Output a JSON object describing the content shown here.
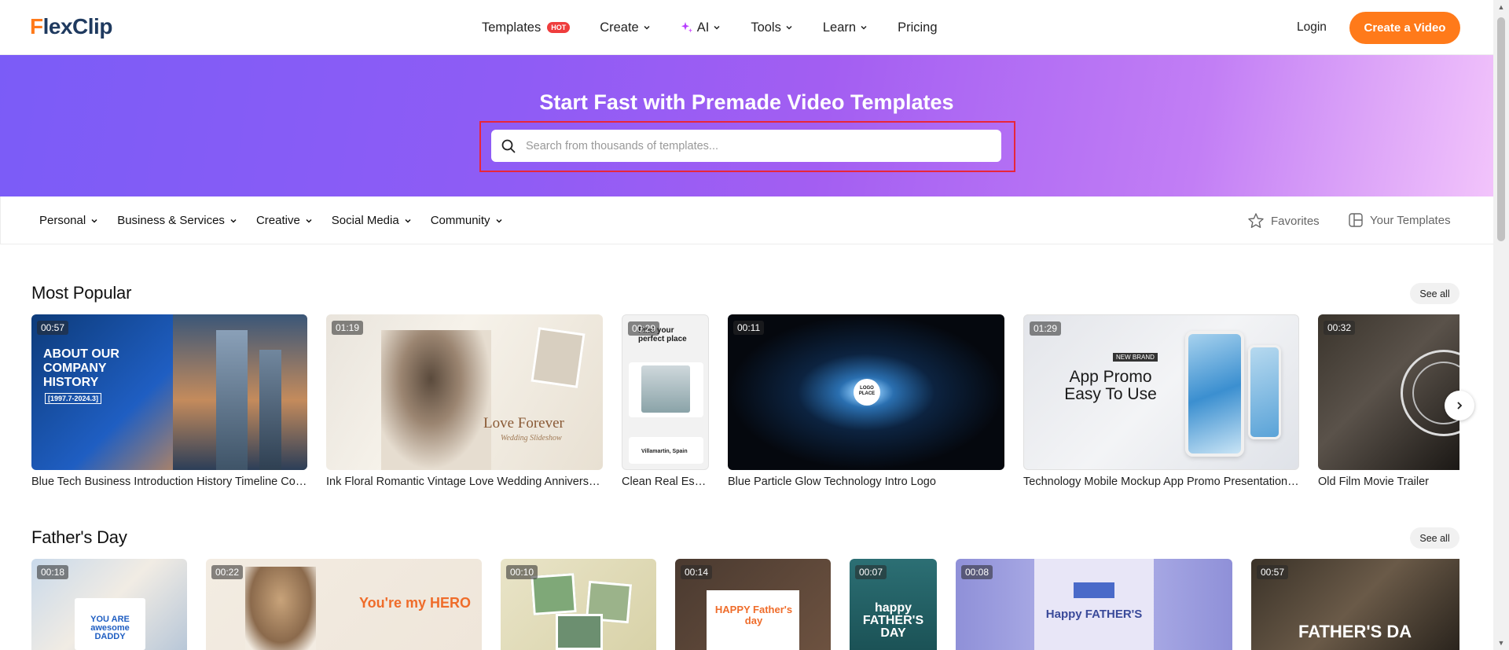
{
  "header": {
    "logo_f": "F",
    "logo_rest": "lexClip",
    "nav": [
      {
        "label": "Templates",
        "badge": "HOT"
      },
      {
        "label": "Create"
      },
      {
        "label": "AI"
      },
      {
        "label": "Tools"
      },
      {
        "label": "Learn"
      },
      {
        "label": "Pricing"
      }
    ],
    "login": "Login",
    "cta": "Create a Video"
  },
  "hero": {
    "title": "Start Fast with Premade Video Templates",
    "search_placeholder": "Search from thousands of templates...",
    "search_value": ""
  },
  "categories": [
    {
      "label": "Personal"
    },
    {
      "label": "Business & Services"
    },
    {
      "label": "Creative"
    },
    {
      "label": "Social Media"
    },
    {
      "label": "Community"
    }
  ],
  "favorites": "Favorites",
  "your_templates": "Your Templates",
  "sections": [
    {
      "title": "Most Popular",
      "see_all": "See all",
      "cards": [
        {
          "duration": "00:57",
          "label": "Blue Tech Business Introduction History Timeline Conf...",
          "art": "ABOUT OUR COMPANY HISTORY",
          "art_sub": "[1997.7-2024.3]"
        },
        {
          "duration": "01:19",
          "label": "Ink Floral Romantic Vintage Love Wedding Anniversary ...",
          "art": "Love Forever",
          "art_sub": "Wedding Slideshow"
        },
        {
          "duration": "00:29",
          "label": "Clean Real Estat...",
          "art": "Find your perfect place",
          "art_sub": "Villamartin, Spain"
        },
        {
          "duration": "00:11",
          "label": "Blue Particle Glow Technology Intro Logo",
          "art": "LOGO PLACE"
        },
        {
          "duration": "01:29",
          "label": "Technology Mobile Mockup App Promo Presentation V...",
          "art": "App Promo Easy To Use",
          "art_sub": "NEW BRAND"
        },
        {
          "duration": "00:32",
          "label": "Old Film Movie Trailer"
        }
      ]
    },
    {
      "title": "Father's Day",
      "see_all": "See all",
      "cards": [
        {
          "duration": "00:18",
          "art": "YOU ARE awesome DADDY"
        },
        {
          "duration": "00:22",
          "art": "You're my HERO"
        },
        {
          "duration": "00:10"
        },
        {
          "duration": "00:14",
          "art": "HAPPY Father's day"
        },
        {
          "duration": "00:07",
          "art": "happy FATHER'S DAY"
        },
        {
          "duration": "00:08",
          "art": "Happy FATHER'S"
        },
        {
          "duration": "00:57",
          "art": "FATHER'S DA"
        }
      ]
    }
  ],
  "colors": {
    "brand_orange": "#ff7a1a",
    "brand_navy": "#1f3a5f",
    "hot_red": "#ef3d3d",
    "highlight_red": "#e8263a"
  }
}
